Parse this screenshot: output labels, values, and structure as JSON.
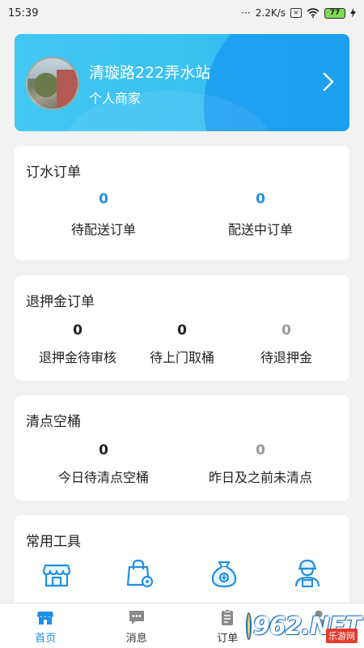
{
  "status_bar": {
    "time": "15:39",
    "net_speed": "2.2K/s",
    "battery": "77"
  },
  "store": {
    "name": "清璇路222弄水站",
    "type": "个人商家"
  },
  "water_orders": {
    "title": "订水订单",
    "stats": [
      {
        "value": "0",
        "label": "待配送订单",
        "color": "#1f8fe6"
      },
      {
        "value": "0",
        "label": "配送中订单",
        "color": "#1f8fe6"
      }
    ]
  },
  "deposit_refund": {
    "title": "退押金订单",
    "stats": [
      {
        "value": "0",
        "label": "退押金待审核",
        "color": "#222222"
      },
      {
        "value": "0",
        "label": "待上门取桶",
        "color": "#222222"
      },
      {
        "value": "0",
        "label": "待退押金",
        "color": "#999999"
      }
    ]
  },
  "empty_buckets": {
    "title": "清点空桶",
    "stats": [
      {
        "value": "0",
        "label": "今日待清点空桶",
        "color": "#222222"
      },
      {
        "value": "0",
        "label": "昨日及之前未清点",
        "color": "#999999"
      }
    ]
  },
  "tools": {
    "title": "常用工具",
    "items": [
      {
        "icon": "store-icon"
      },
      {
        "icon": "shopping-bag-settings-icon"
      },
      {
        "icon": "money-bag-icon"
      },
      {
        "icon": "delivery-person-icon"
      }
    ]
  },
  "tabbar": {
    "items": [
      {
        "label": "首页",
        "icon": "home-icon",
        "active": true
      },
      {
        "label": "消息",
        "icon": "message-icon",
        "active": false
      },
      {
        "label": "订单",
        "icon": "order-icon",
        "active": false
      },
      {
        "label": "",
        "icon": "profile-icon",
        "active": false
      }
    ]
  },
  "watermark": {
    "logo_text": "962.NET",
    "tag_text": "乐游网"
  },
  "colors": {
    "accent": "#1f8fe6",
    "card_gradient_start": "#43c7f3",
    "card_gradient_end": "#26a8ef"
  }
}
